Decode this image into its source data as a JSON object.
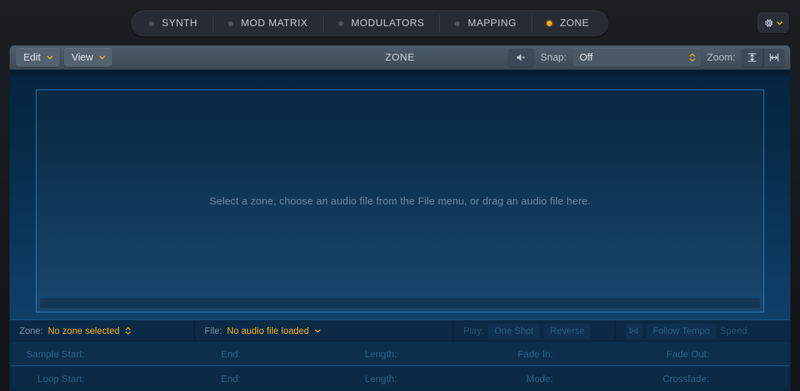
{
  "tabs": [
    {
      "label": "SYNTH",
      "active": false,
      "icon": "status-dot-icon"
    },
    {
      "label": "MOD MATRIX",
      "active": false,
      "icon": "status-dot-icon"
    },
    {
      "label": "MODULATORS",
      "active": false,
      "icon": "status-dot-icon"
    },
    {
      "label": "MAPPING",
      "active": false,
      "icon": "status-dot-icon"
    },
    {
      "label": "ZONE",
      "active": true,
      "icon": "status-dot-icon"
    }
  ],
  "header": {
    "settings_icon": "gear-icon",
    "settings_chevron": "chevron-down-icon"
  },
  "toolbar": {
    "edit_label": "Edit",
    "view_label": "View",
    "title": "ZONE",
    "audition_icon": "speaker-icon",
    "snap_label": "Snap:",
    "snap_value": "Off",
    "snap_stepper_icon": "stepper-up-down-icon",
    "zoom_label": "Zoom:",
    "zoom_vertical_icon": "zoom-vertical-icon",
    "zoom_horizontal_icon": "zoom-horizontal-icon"
  },
  "stage": {
    "placeholder": "Select a zone, choose an audio file from the File menu, or drag an audio file here."
  },
  "infobar": {
    "zone_label": "Zone:",
    "zone_value": "No zone selected",
    "zone_stepper_icon": "stepper-up-down-icon",
    "file_label": "File:",
    "file_value": "No audio file loaded",
    "file_chevron": "chevron-down-icon",
    "play_label": "Play:",
    "play_one_shot": "One Shot",
    "play_reverse": "Reverse",
    "tempo_sync_icon": "tempo-sync-icon",
    "follow_tempo": "Follow Tempo",
    "speed_label": "Speed:"
  },
  "params": {
    "row1": [
      "Sample Start:",
      "End:",
      "Length:",
      "Fade In:",
      "Fade Out:"
    ],
    "row2": [
      "Loop Start:",
      "End:",
      "Length:",
      "Mode:",
      "Crossfade:"
    ]
  },
  "colors": {
    "accent_amber": "#f2b01e",
    "panel_blue": "#0b2135",
    "toolbar_gray": "#45535f",
    "border_blue": "#2d7fc4",
    "disabled_blue": "#2c5c7d"
  }
}
